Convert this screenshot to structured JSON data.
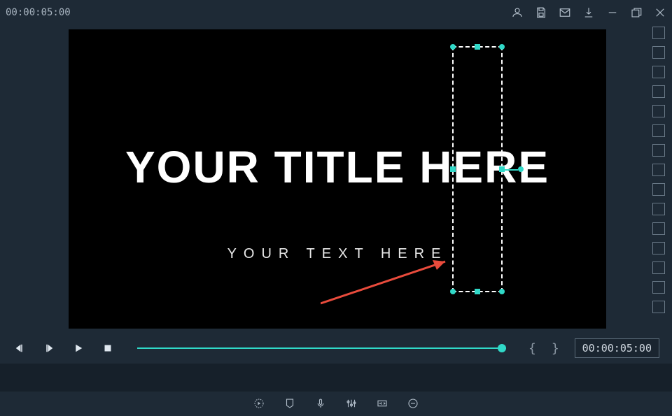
{
  "topbar": {
    "timecode": "00:00:05:00"
  },
  "preview": {
    "title": "YOUR TITLE HERE",
    "subtitle": "YOUR TEXT HERE"
  },
  "playback": {
    "timecode": "00:00:05:00",
    "brace_open": "{",
    "brace_close": "}"
  },
  "icons": {
    "account": "account",
    "save": "save",
    "mail": "mail",
    "download": "download",
    "minimize": "minimize",
    "maximize": "maximize",
    "close": "close"
  }
}
